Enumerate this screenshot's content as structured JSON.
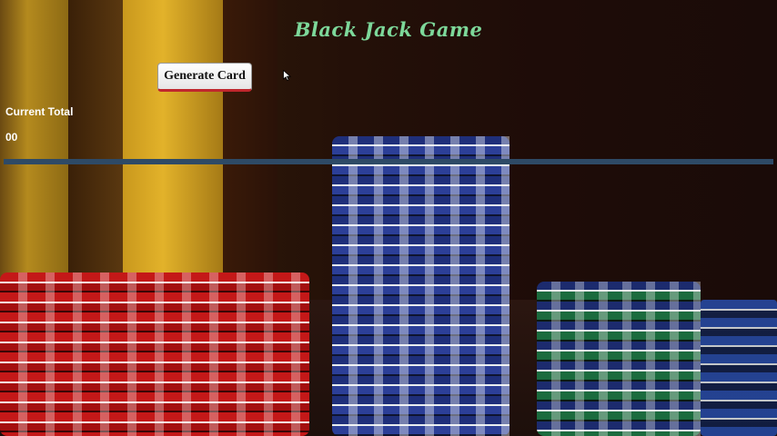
{
  "header": {
    "title": "Black Jack Game"
  },
  "controls": {
    "generate_label": "Generate Card"
  },
  "score": {
    "label": "Current Total",
    "value": "00"
  },
  "colors": {
    "title": "#7dd89a",
    "divider": "#2e4a66",
    "button_accent": "#c0272d"
  },
  "icons": {
    "cursor": "mouse-pointer-icon"
  }
}
